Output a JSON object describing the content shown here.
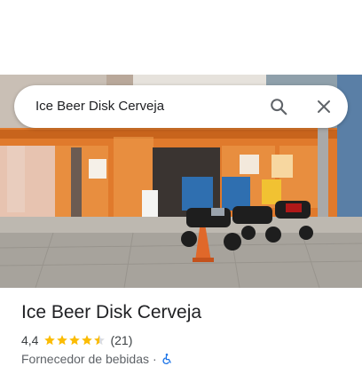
{
  "search": {
    "query": "Ice Beer Disk Cerveja",
    "search_icon": "search-icon",
    "close_icon": "close-icon"
  },
  "photo": {
    "description_icon": "storefront-photo"
  },
  "place": {
    "name": "Ice Beer Disk Cerveja",
    "rating": "4,4",
    "stars": 4.4,
    "review_count": "(21)",
    "category": "Fornecedor de bebidas",
    "separator": "·",
    "accessibility_icon": "wheelchair-icon"
  },
  "colors": {
    "star": "#fbbc04",
    "accessibility": "#1a73e8",
    "text_primary": "#202124",
    "text_secondary": "#5f6368"
  }
}
